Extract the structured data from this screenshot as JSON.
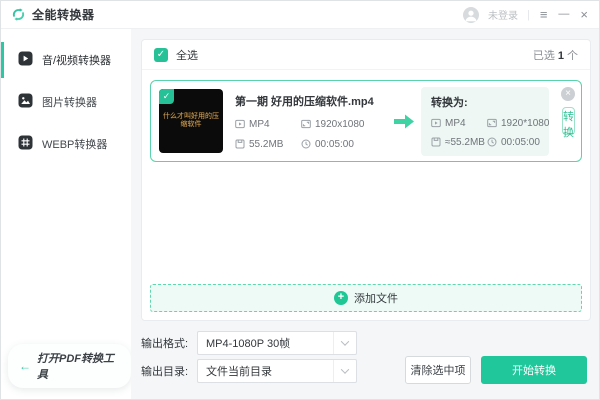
{
  "window": {
    "title": "全能转换器",
    "user_status": "未登录"
  },
  "icons": {
    "menu": "≡",
    "minimize": "—",
    "close": "×",
    "card_close": "×",
    "check": "✓",
    "plus": "+",
    "back_arrow": "←",
    "separator": "|"
  },
  "sidebar": {
    "items": [
      {
        "label": "音/视频转换器",
        "active": true
      },
      {
        "label": "图片转换器",
        "active": false
      },
      {
        "label": "WEBP转换器",
        "active": false
      }
    ],
    "pdf_tool_label": "打开PDF转换工具"
  },
  "list": {
    "select_all": "全选",
    "selected_prefix": "已选",
    "selected_count": "1",
    "selected_suffix": "个",
    "add_files": "添加文件"
  },
  "file_card": {
    "thumbnail_text": "什么才叫好用的压缩软件",
    "name": "第一期 好用的压缩软件.mp4",
    "source": {
      "format": "MP4",
      "resolution": "1920x1080",
      "size": "55.2MB",
      "duration": "00:05:00"
    },
    "target_label": "转换为:",
    "target": {
      "format": "MP4",
      "resolution": "1920*1080",
      "size": "≈55.2MB",
      "duration": "00:05:00"
    },
    "convert_button": "转换"
  },
  "output": {
    "format_label": "输出格式:",
    "format_value": "MP4-1080P 30帧",
    "dir_label": "输出目录:",
    "dir_value": "文件当前目录"
  },
  "actions": {
    "clear_selected": "清除选中项",
    "start_convert": "开始转换"
  },
  "colors": {
    "accent": "#1fc79a",
    "card_border": "#5ad2ab",
    "thumb_text": "#cfa057"
  }
}
